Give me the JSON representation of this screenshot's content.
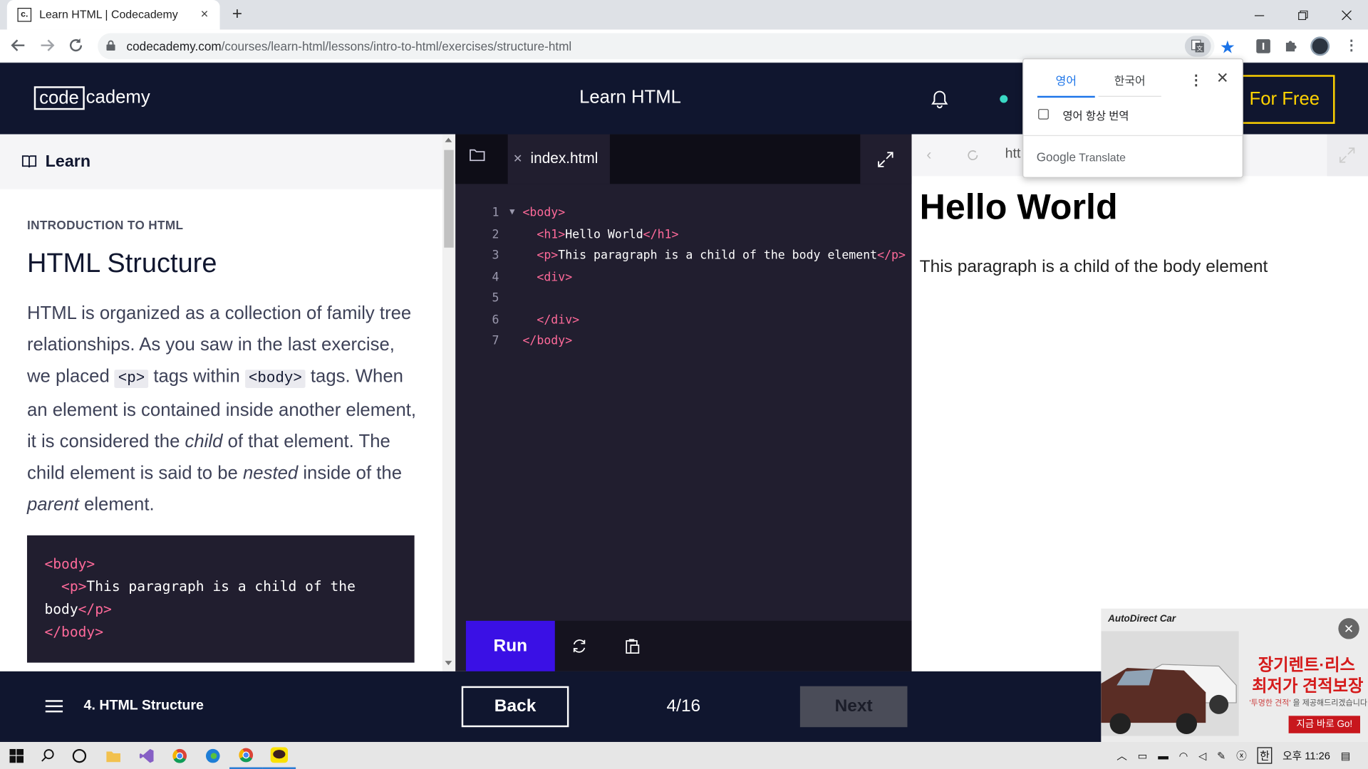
{
  "browser": {
    "tab_title": "Learn HTML | Codecademy",
    "tab_favicon": "c.",
    "url_host": "codecademy.com",
    "url_path": "/courses/learn-html/lessons/intro-to-html/exercises/structure-html",
    "new_tab_glyph": "+",
    "tab_close_glyph": "×"
  },
  "header": {
    "logo_box": "code",
    "logo_rest": "cademy",
    "course_title": "Learn HTML",
    "cta_label": "For Free"
  },
  "lesson": {
    "learn_label": "Learn",
    "kicker": "INTRODUCTION TO HTML",
    "title": "HTML Structure",
    "p1": "HTML is organized as a collection of family tree relationships. As you saw in the last exercise, we placed ",
    "code1": "<p>",
    "p2": " tags within ",
    "code2": "<body>",
    "p3": " tags. When an element is contained inside another element, it is considered the ",
    "em1": "child",
    "p4": " of that element. The child element is said to be ",
    "em2": "nested",
    "p5": " inside of the ",
    "em3": "parent",
    "p6": " element.",
    "codeblock": {
      "l1": "<body>",
      "l2_open": "<p>",
      "l2_text": "This paragraph is a child of the",
      "l3_text": "body",
      "l3_close": "</p>",
      "l4": "</body>"
    }
  },
  "editor": {
    "file_name": "index.html",
    "lines": [
      {
        "n": "1",
        "parts": [
          [
            "tag",
            "<body>"
          ]
        ]
      },
      {
        "n": "2",
        "parts": [
          [
            "sp",
            "  "
          ],
          [
            "tag",
            "<h1>"
          ],
          [
            "txt",
            "Hello World"
          ],
          [
            "tag",
            "</h1>"
          ]
        ]
      },
      {
        "n": "3",
        "parts": [
          [
            "sp",
            "  "
          ],
          [
            "tag",
            "<p>"
          ],
          [
            "txt",
            "This paragraph is a child of the body element"
          ],
          [
            "tag",
            "</p>"
          ]
        ]
      },
      {
        "n": "4",
        "parts": [
          [
            "sp",
            "  "
          ],
          [
            "tag",
            "<div>"
          ]
        ]
      },
      {
        "n": "5",
        "parts": []
      },
      {
        "n": "6",
        "parts": [
          [
            "sp",
            "  "
          ],
          [
            "tag",
            "</div>"
          ]
        ]
      },
      {
        "n": "7",
        "parts": [
          [
            "tag",
            "</body>"
          ]
        ]
      }
    ],
    "fold_glyph": "▼",
    "run_label": "Run"
  },
  "preview": {
    "url_partial": "htt",
    "heading": "Hello World",
    "paragraph": "This paragraph is a child of the body element"
  },
  "translate_popup": {
    "tab_source": "영어",
    "tab_target": "한국어",
    "always_translate": "영어 항상 번역",
    "brand_google": "Google",
    "brand_translate": "Translate"
  },
  "footer": {
    "lesson_label": "4. HTML Structure",
    "back_label": "Back",
    "pager": "4/16",
    "next_label": "Next"
  },
  "ad": {
    "brand": "AutoDirect Car",
    "line1": "장기렌트·리스",
    "line2": "최저가 견적보장",
    "line3_a": "'투명한 견적'",
    "line3_b": "을 제공해드리겠습니다.",
    "cta": "지금 바로 Go!"
  },
  "taskbar": {
    "ime": "한",
    "time": "오후 11:26"
  },
  "colors": {
    "cc_navy": "#10162f",
    "cc_yellow": "#ffd300",
    "run_purple": "#3a10e5",
    "tag_pink": "#ff6a9a",
    "editor_bg": "#211e2f"
  }
}
